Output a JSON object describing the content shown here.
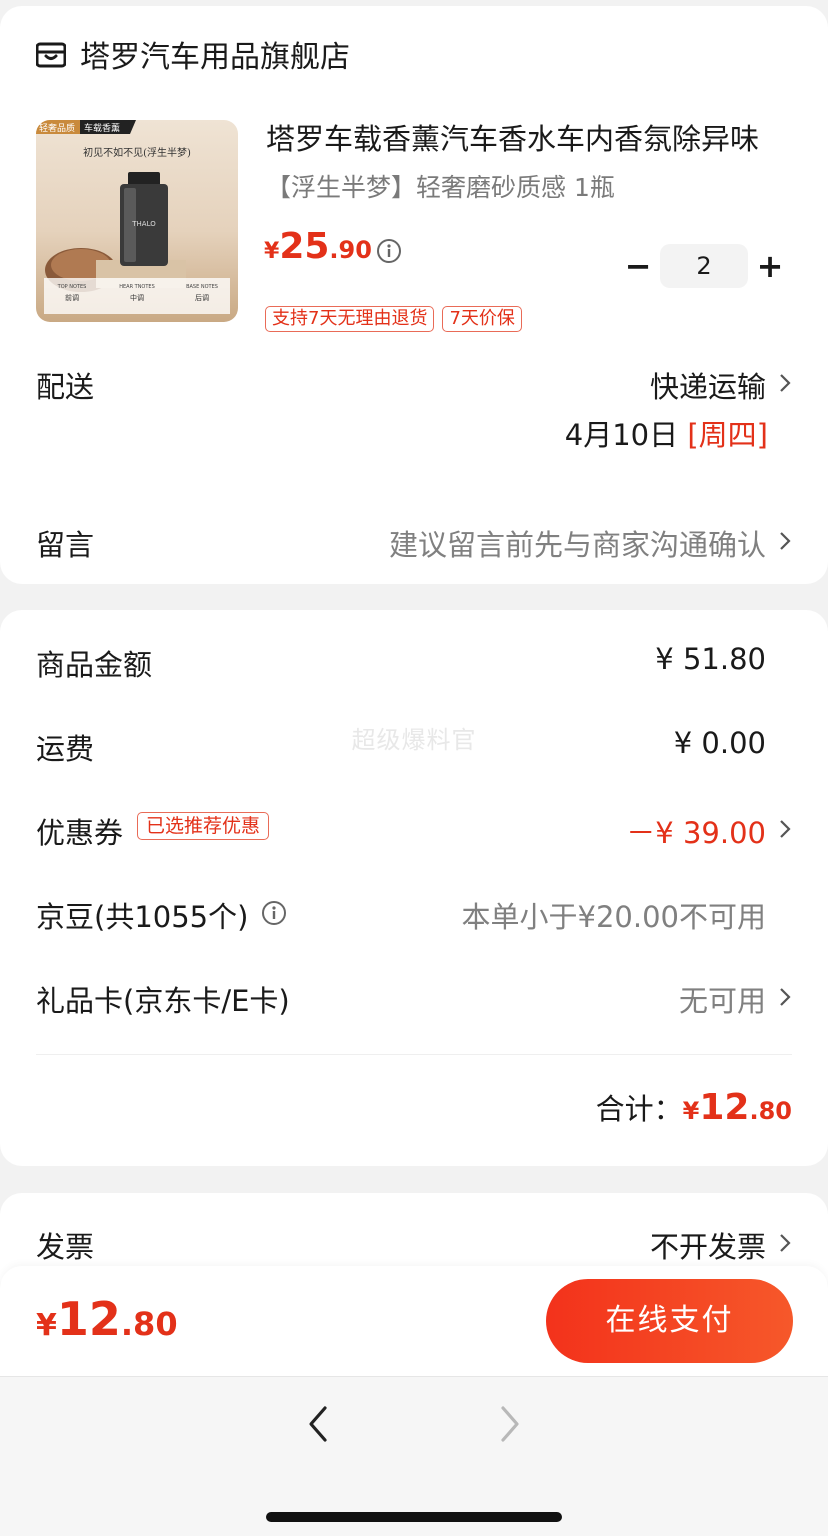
{
  "store": {
    "name": "塔罗汽车用品旗舰店",
    "icon": "store-icon"
  },
  "product": {
    "title": "塔罗车载香薰汽车香水车内香氛除异味",
    "variant": "【浮生半梦】轻奢磨砂质感 1瓶",
    "price_currency": "¥",
    "price_int": "25",
    "price_dec": ".90",
    "quantity": "2",
    "minus_label": "−",
    "plus_label": "+",
    "tags": [
      "支持7天无理由退货",
      "7天价保"
    ],
    "image_text": {
      "badge1": "轻奢品质",
      "badge2": "车载香薰",
      "headline": "初见不如不见(浮生半梦)",
      "bottle": "THALO",
      "notes_top": "TOP NOTES",
      "notes_heart": "HEAR TNOTES",
      "notes_base": "BASE NOTES",
      "note1": "前调",
      "note2": "中调",
      "note3": "后调"
    }
  },
  "delivery": {
    "label": "配送",
    "method": "快递运输",
    "date": "4月10日",
    "weekday": "[周四]"
  },
  "message": {
    "label": "留言",
    "placeholder": "建议留言前先与商家沟通确认"
  },
  "summary": {
    "goods_label": "商品金额",
    "goods_value": "¥ 51.80",
    "shipping_label": "运费",
    "shipping_value": "¥ 0.00",
    "coupon_label": "优惠券",
    "coupon_badge": "已选推荐优惠",
    "coupon_value": "－¥ 39.00",
    "beans_label": "京豆(共1055个)",
    "beans_value": "本单小于¥20.00不可用",
    "giftcard_label": "礼品卡(京东卡/E卡)",
    "giftcard_value": "无可用",
    "total_label": "合计：",
    "total_currency": "¥",
    "total_int": "12",
    "total_dec": ".80"
  },
  "watermark": "超级爆料官",
  "invoice": {
    "label": "发票",
    "value": "不开发票"
  },
  "bottom": {
    "currency": "¥",
    "int": "12",
    "dec": ".80",
    "pay_label": "在线支付"
  },
  "colors": {
    "accent": "#e33119",
    "pay_start": "#f3321b",
    "pay_end": "#f6582a"
  }
}
